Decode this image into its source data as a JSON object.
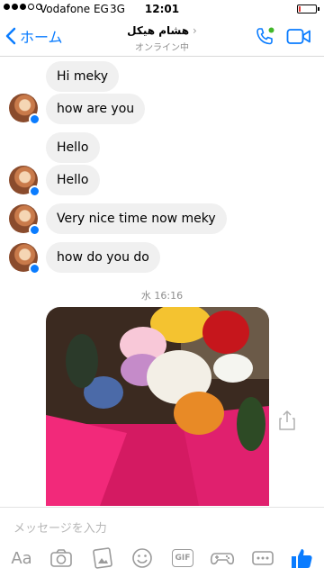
{
  "status_bar": {
    "carrier": "Vodafone EG",
    "network": "3G",
    "time": "12:01",
    "battery_level": 0.12
  },
  "header": {
    "back_label": "ホーム",
    "contact_name": "هشام هيكل",
    "status": "オンライン中",
    "colors": {
      "accent": "#0a7cff",
      "online": "#42b72a"
    }
  },
  "messages": [
    {
      "text": "Hi meky"
    },
    {
      "text": "how are you"
    },
    {
      "text": "Hello"
    },
    {
      "text": "Hello"
    },
    {
      "text": "Very nice time now meky"
    },
    {
      "text": "how do you do"
    }
  ],
  "timestamp": "水 16:16",
  "composer": {
    "placeholder": "メッセージを入力",
    "text_tool_label": "Aa",
    "gif_label": "GIF",
    "icons": [
      "camera-icon",
      "gallery-icon",
      "emoji-icon",
      "gif-icon",
      "game-icon",
      "more-icon",
      "like-icon"
    ]
  }
}
